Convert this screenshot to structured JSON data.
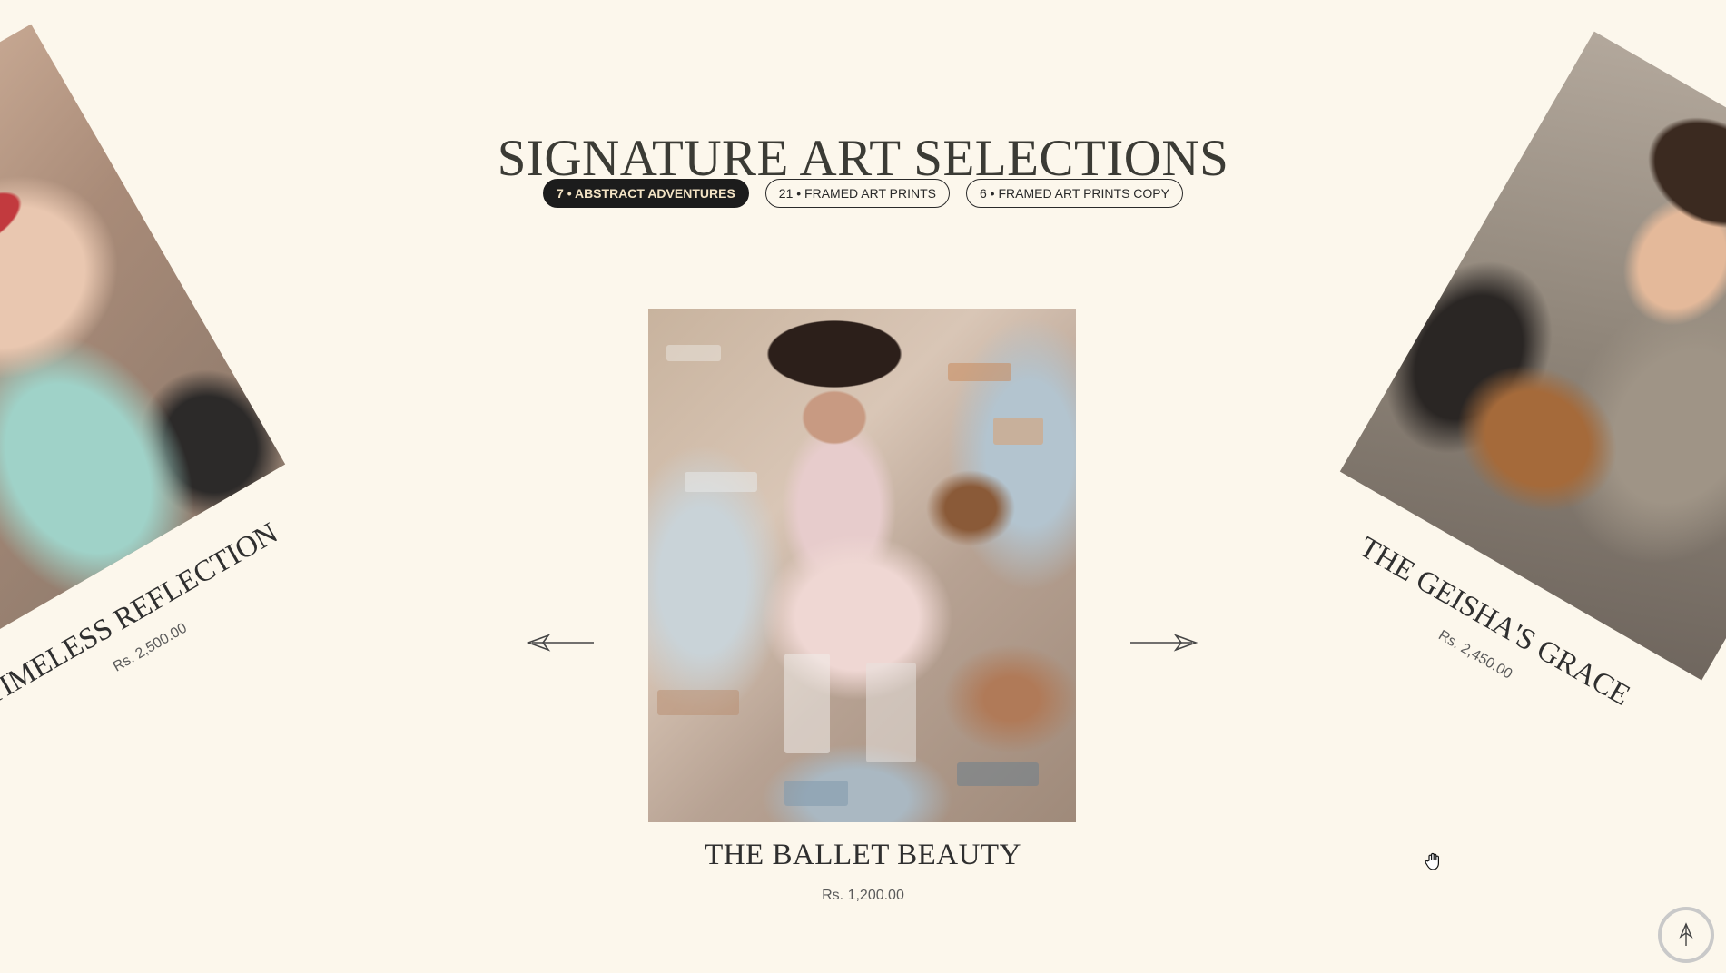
{
  "section": {
    "title": "SIGNATURE ART SELECTIONS"
  },
  "tabs": [
    {
      "label": "7 • ABSTRACT ADVENTURES",
      "active": true
    },
    {
      "label": "21 • FRAMED ART PRINTS",
      "active": false
    },
    {
      "label": "6 • FRAMED ART PRINTS COPY",
      "active": false
    }
  ],
  "carousel": {
    "prev": {
      "name": "TIMELESS REFLECTION",
      "price": "Rs. 2,500.00"
    },
    "current": {
      "name": "THE BALLET BEAUTY",
      "price": "Rs. 1,200.00"
    },
    "next": {
      "name": "THE GEISHA'S GRACE",
      "price": "Rs. 2,450.00"
    }
  },
  "icons": {
    "prev": "arrow-left-icon",
    "next": "arrow-right-icon",
    "cursor": "grab-hand-icon",
    "scroll_top": "arrow-up-icon"
  },
  "colors": {
    "background": "#fcf7ec",
    "active_tab_bg": "#1c1c1c",
    "active_tab_text": "#f3e3c4"
  }
}
